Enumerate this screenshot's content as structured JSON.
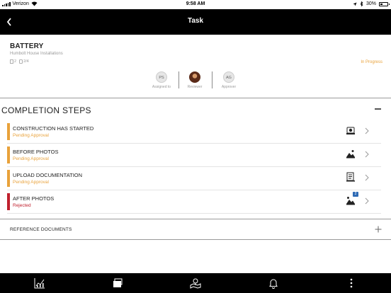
{
  "status_bar": {
    "carrier": "Verizon",
    "time": "9:58 AM",
    "battery": "30%"
  },
  "nav": {
    "title": "Task"
  },
  "task": {
    "title": "BATTERY",
    "subtitle": "Humbolt House Installations",
    "attachments_count": "2",
    "checklist_count": "2/4",
    "status": "In Progress",
    "status_color": "#e9a23b",
    "people": [
      {
        "initials": "PS",
        "role": "Assigned to"
      },
      {
        "initials": "",
        "role": "Reviewer"
      },
      {
        "initials": "AG",
        "role": "Approver"
      }
    ]
  },
  "completion_steps": {
    "header": "COMPLETION STEPS",
    "items": [
      {
        "name": "CONSTRUCTION HAS STARTED",
        "state": "Pending Approval",
        "color": "#e9a23b",
        "icon": "camera-icon"
      },
      {
        "name": "BEFORE PHOTOS",
        "state": "Pending Approval",
        "color": "#e9a23b",
        "icon": "photo-icon"
      },
      {
        "name": "UPLOAD DOCUMENTATION",
        "state": "Pending Approval",
        "color": "#e9a23b",
        "icon": "document-icon"
      },
      {
        "name": "AFTER PHOTOS",
        "state": "Rejected",
        "color": "#c0202e",
        "icon": "photo-multi-icon",
        "badge": "2"
      }
    ]
  },
  "reference_documents": {
    "label": "REFERENCE DOCUMENTS"
  },
  "tab_bar": {
    "tabs": [
      "chart-icon",
      "folders-icon",
      "map-icon",
      "bell-icon",
      "more-icon"
    ]
  }
}
